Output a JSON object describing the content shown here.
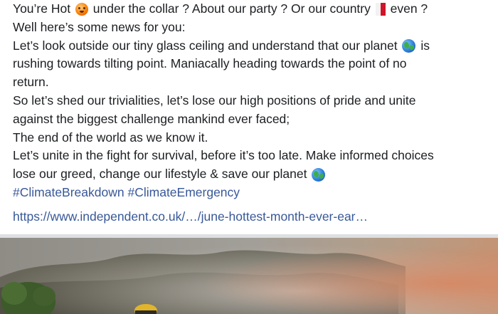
{
  "post": {
    "line1": {
      "part_a": "You’re Hot ",
      "part_b": " under the collar ? About our party ? Or our country ",
      "part_c": " even ?"
    },
    "line2": "Well here’s some news for you:",
    "line3": {
      "part_a": "Let’s look outside our tiny glass ceiling and understand that our planet ",
      "part_b": " is"
    },
    "line4": "rushing towards tilting point. Maniacally heading towards the point of no",
    "line5": "return.",
    "line6": "So let’s shed our trivialities, let’s lose our high positions of pride and unite",
    "line7": "against the biggest challenge mankind ever faced;",
    "line8": "The end of the world as we know it.",
    "line9": "Let’s unite in the fight for survival, before it’s too late. Make informed choices",
    "line10": {
      "part_a": "lose our greed, change our lifestyle & save our planet "
    },
    "hashtags": [
      "#ClimateBreakdown",
      "#ClimateEmergency"
    ],
    "link": "https://www.independent.co.uk/…/june-hottest-month-ever-ear…"
  },
  "icons": {
    "hot_face": "hot-face-emoji",
    "country_flag": "malta-flag-emoji",
    "planet": "globe-emoji"
  },
  "colors": {
    "text": "#1c1e21",
    "link": "#385898",
    "divider": "#dddfe2",
    "background": "#ffffff"
  }
}
